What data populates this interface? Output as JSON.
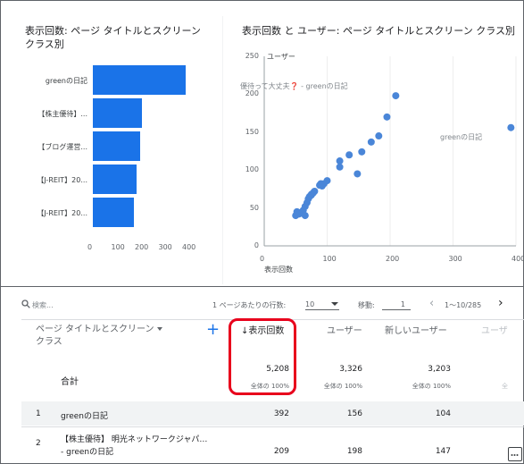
{
  "left_card": {
    "title_line1": "表示回数: ページ タイトルとスクリーン",
    "title_line2": "クラス別"
  },
  "right_card": {
    "title": "表示回数 と ユーザー: ページ タイトルとスクリーン クラス別"
  },
  "chart_data": [
    {
      "type": "bar",
      "orientation": "horizontal",
      "categories": [
        "greenの日記",
        "【株主優待】...",
        "【ブログ運営...",
        "【J-REIT】20...",
        "【J-REIT】20..."
      ],
      "values": [
        392,
        209,
        200,
        185,
        175
      ],
      "xlim": [
        0,
        400
      ],
      "xticks": [
        "0",
        "100",
        "200",
        "300",
        "400"
      ]
    },
    {
      "type": "scatter",
      "ylabel": "ユーザー",
      "xlabel": "表示回数",
      "xlim": [
        0,
        400
      ],
      "ylim": [
        0,
        250
      ],
      "xticks": [
        "0",
        "100",
        "200",
        "300",
        "400"
      ],
      "yticks": [
        "0",
        "50",
        "100",
        "150",
        "200",
        "250"
      ],
      "annotations": [
        {
          "text": "優待って大丈夫❓ - greenの日記",
          "x": 80,
          "y": 102
        },
        {
          "text": "greenの日記",
          "x": 392,
          "y": 140
        }
      ],
      "points": [
        [
          392,
          156
        ],
        [
          209,
          198
        ],
        [
          195,
          170
        ],
        [
          182,
          145
        ],
        [
          170,
          137
        ],
        [
          155,
          124
        ],
        [
          148,
          95
        ],
        [
          135,
          120
        ],
        [
          120,
          112
        ],
        [
          120,
          104
        ],
        [
          100,
          86
        ],
        [
          95,
          82
        ],
        [
          90,
          82
        ],
        [
          88,
          80
        ],
        [
          80,
          72
        ],
        [
          78,
          70
        ],
        [
          75,
          67
        ],
        [
          72,
          65
        ],
        [
          70,
          62
        ],
        [
          68,
          57
        ],
        [
          65,
          52
        ],
        [
          62,
          47
        ],
        [
          60,
          43
        ],
        [
          58,
          44
        ],
        [
          55,
          42
        ],
        [
          52,
          45
        ],
        [
          50,
          40
        ],
        [
          65,
          40
        ],
        [
          75,
          68
        ],
        [
          92,
          79
        ]
      ]
    }
  ],
  "toolbar": {
    "search_placeholder": "検索...",
    "rows_label": "1 ページあたりの行数:",
    "rows_value": "10",
    "goto_label": "移動:",
    "goto_value": "1",
    "range": "1〜10/285"
  },
  "table": {
    "dimension_header_line1": "ページ タイトルとスクリーン",
    "dimension_header_line2": "クラス",
    "add_icon": "plus-icon",
    "columns": [
      "↓表示回数",
      "ユーザー",
      "新しいユーザー",
      "ユーザ"
    ],
    "total_label": "合計",
    "totals": [
      "5,208",
      "3,326",
      "3,203"
    ],
    "totals_sub": [
      "全体の 100%",
      "全体の 100%",
      "全体の 100%",
      "全"
    ],
    "rows": [
      {
        "index": "1",
        "title_line1": "greenの日記",
        "title_line2": "",
        "values": [
          "392",
          "156",
          "104"
        ]
      },
      {
        "index": "2",
        "title_line1": "【株主優待】 明光ネットワークジャパ…",
        "title_line2": "- greenの日記",
        "values": [
          "209",
          "198",
          "147"
        ]
      }
    ]
  },
  "colors": {
    "bar": "#1a73e8",
    "point": "#4a86d8",
    "highlight": "#e8001c"
  }
}
